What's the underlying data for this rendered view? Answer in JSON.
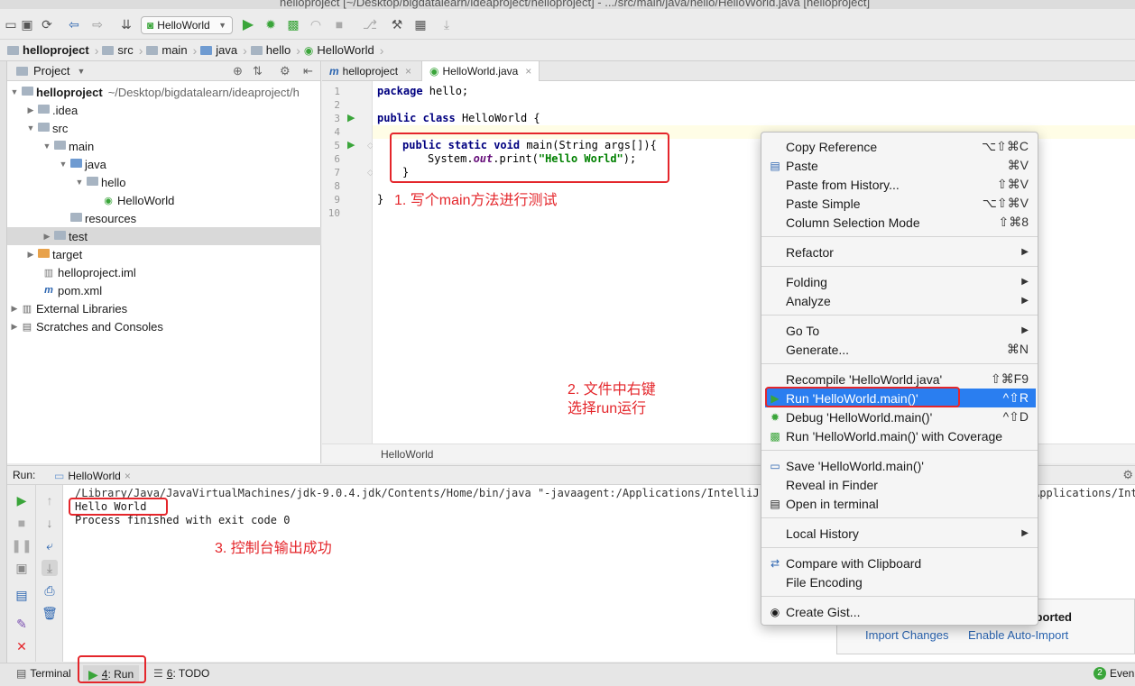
{
  "window_title": "helloproject [~/Desktop/bigdatalearn/ideaproject/helloproject] - .../src/main/java/hello/HelloWorld.java [helloproject]",
  "toolbar": {
    "run_config": "HelloWorld"
  },
  "breadcrumbs": [
    "helloproject",
    "src",
    "main",
    "java",
    "hello",
    "HelloWorld"
  ],
  "project_panel": {
    "title": "Project",
    "tree": [
      {
        "label": "helloproject",
        "extra": "~/Desktop/bigdatalearn/ideaproject/h"
      },
      {
        "label": ".idea"
      },
      {
        "label": "src"
      },
      {
        "label": "main"
      },
      {
        "label": "java"
      },
      {
        "label": "hello"
      },
      {
        "label": "HelloWorld"
      },
      {
        "label": "resources"
      },
      {
        "label": "test"
      },
      {
        "label": "target"
      },
      {
        "label": "helloproject.iml"
      },
      {
        "label": "pom.xml"
      },
      {
        "label": "External Libraries"
      },
      {
        "label": "Scratches and Consoles"
      }
    ]
  },
  "editor": {
    "tabs": [
      {
        "label": "helloproject"
      },
      {
        "label": "HelloWorld.java"
      }
    ],
    "line_numbers": [
      "1",
      "2",
      "3",
      "4",
      "5",
      "6",
      "7",
      "8",
      "9",
      "10"
    ],
    "code": {
      "l1_kw": "package",
      "l1_rest": " hello;",
      "l3_kw1": "public",
      "l3_kw2": "class",
      "l3_rest": " HelloWorld {",
      "l5_kw1": "public",
      "l5_kw2": "static",
      "l5_kw3": "void",
      "l5_rest": " main(String args[]){",
      "l6_a": "System.",
      "l6_out": "out",
      "l6_b": ".print(",
      "l6_str": "\"Hello World\"",
      "l6_c": ");",
      "l7": "}",
      "l9": "}"
    },
    "footer": "HelloWorld"
  },
  "run_panel": {
    "label": "Run:",
    "tab": "HelloWorld",
    "console": [
      "/Library/Java/JavaVirtualMachines/jdk-9.0.4.jdk/Contents/Home/bin/java \"-javaagent:/Applications/IntelliJ IDEA.app/Contents/lib/idea_rt.jar=58815:/Applications/Intel",
      "Hello World",
      "Process finished with exit code 0"
    ]
  },
  "bottom_bar": {
    "terminal": "Terminal",
    "run_num": "4",
    "run_label": ": Run",
    "todo_num": "6",
    "todo_label": ": TODO",
    "events_count": "2",
    "events_label": "Even"
  },
  "annotations": {
    "a1": "1. 写个main方法进行测试",
    "a2_line1": "2. 文件中右键",
    "a2_line2": "选择run运行",
    "a3": "3. 控制台输出成功"
  },
  "notification": {
    "title_suffix": "mported",
    "action1": "Import Changes",
    "action2": "Enable Auto-Import"
  },
  "context_menu": {
    "items": [
      {
        "label": "Copy Reference",
        "shortcut": "⌥⇧⌘C"
      },
      {
        "label": "Paste",
        "shortcut": "⌘V"
      },
      {
        "label": "Paste from History...",
        "shortcut": "⇧⌘V"
      },
      {
        "label": "Paste Simple",
        "shortcut": "⌥⇧⌘V"
      },
      {
        "label": "Column Selection Mode",
        "shortcut": "⇧⌘8"
      },
      {
        "label": "Refactor",
        "shortcut": "▶"
      },
      {
        "label": "Folding",
        "shortcut": "▶"
      },
      {
        "label": "Analyze",
        "shortcut": "▶"
      },
      {
        "label": "Go To",
        "shortcut": "▶"
      },
      {
        "label": "Generate...",
        "shortcut": "⌘N"
      },
      {
        "label": "Recompile 'HelloWorld.java'",
        "shortcut": "⇧⌘F9"
      },
      {
        "label": "Run 'HelloWorld.main()'",
        "shortcut": "^⇧R"
      },
      {
        "label": "Debug 'HelloWorld.main()'",
        "shortcut": "^⇧D"
      },
      {
        "label": "Run 'HelloWorld.main()' with Coverage",
        "shortcut": ""
      },
      {
        "label": "Save 'HelloWorld.main()'",
        "shortcut": ""
      },
      {
        "label": "Reveal in Finder",
        "shortcut": ""
      },
      {
        "label": "Open in terminal",
        "shortcut": ""
      },
      {
        "label": "Local History",
        "shortcut": "▶"
      },
      {
        "label": "Compare with Clipboard",
        "shortcut": ""
      },
      {
        "label": "File Encoding",
        "shortcut": ""
      },
      {
        "label": "Create Gist...",
        "shortcut": ""
      }
    ]
  },
  "colors": {
    "annotation_red": "#e4262b",
    "menu_highlight": "#2a7ef0",
    "run_green": "#3aa53a",
    "link_blue": "#2a64b0"
  }
}
